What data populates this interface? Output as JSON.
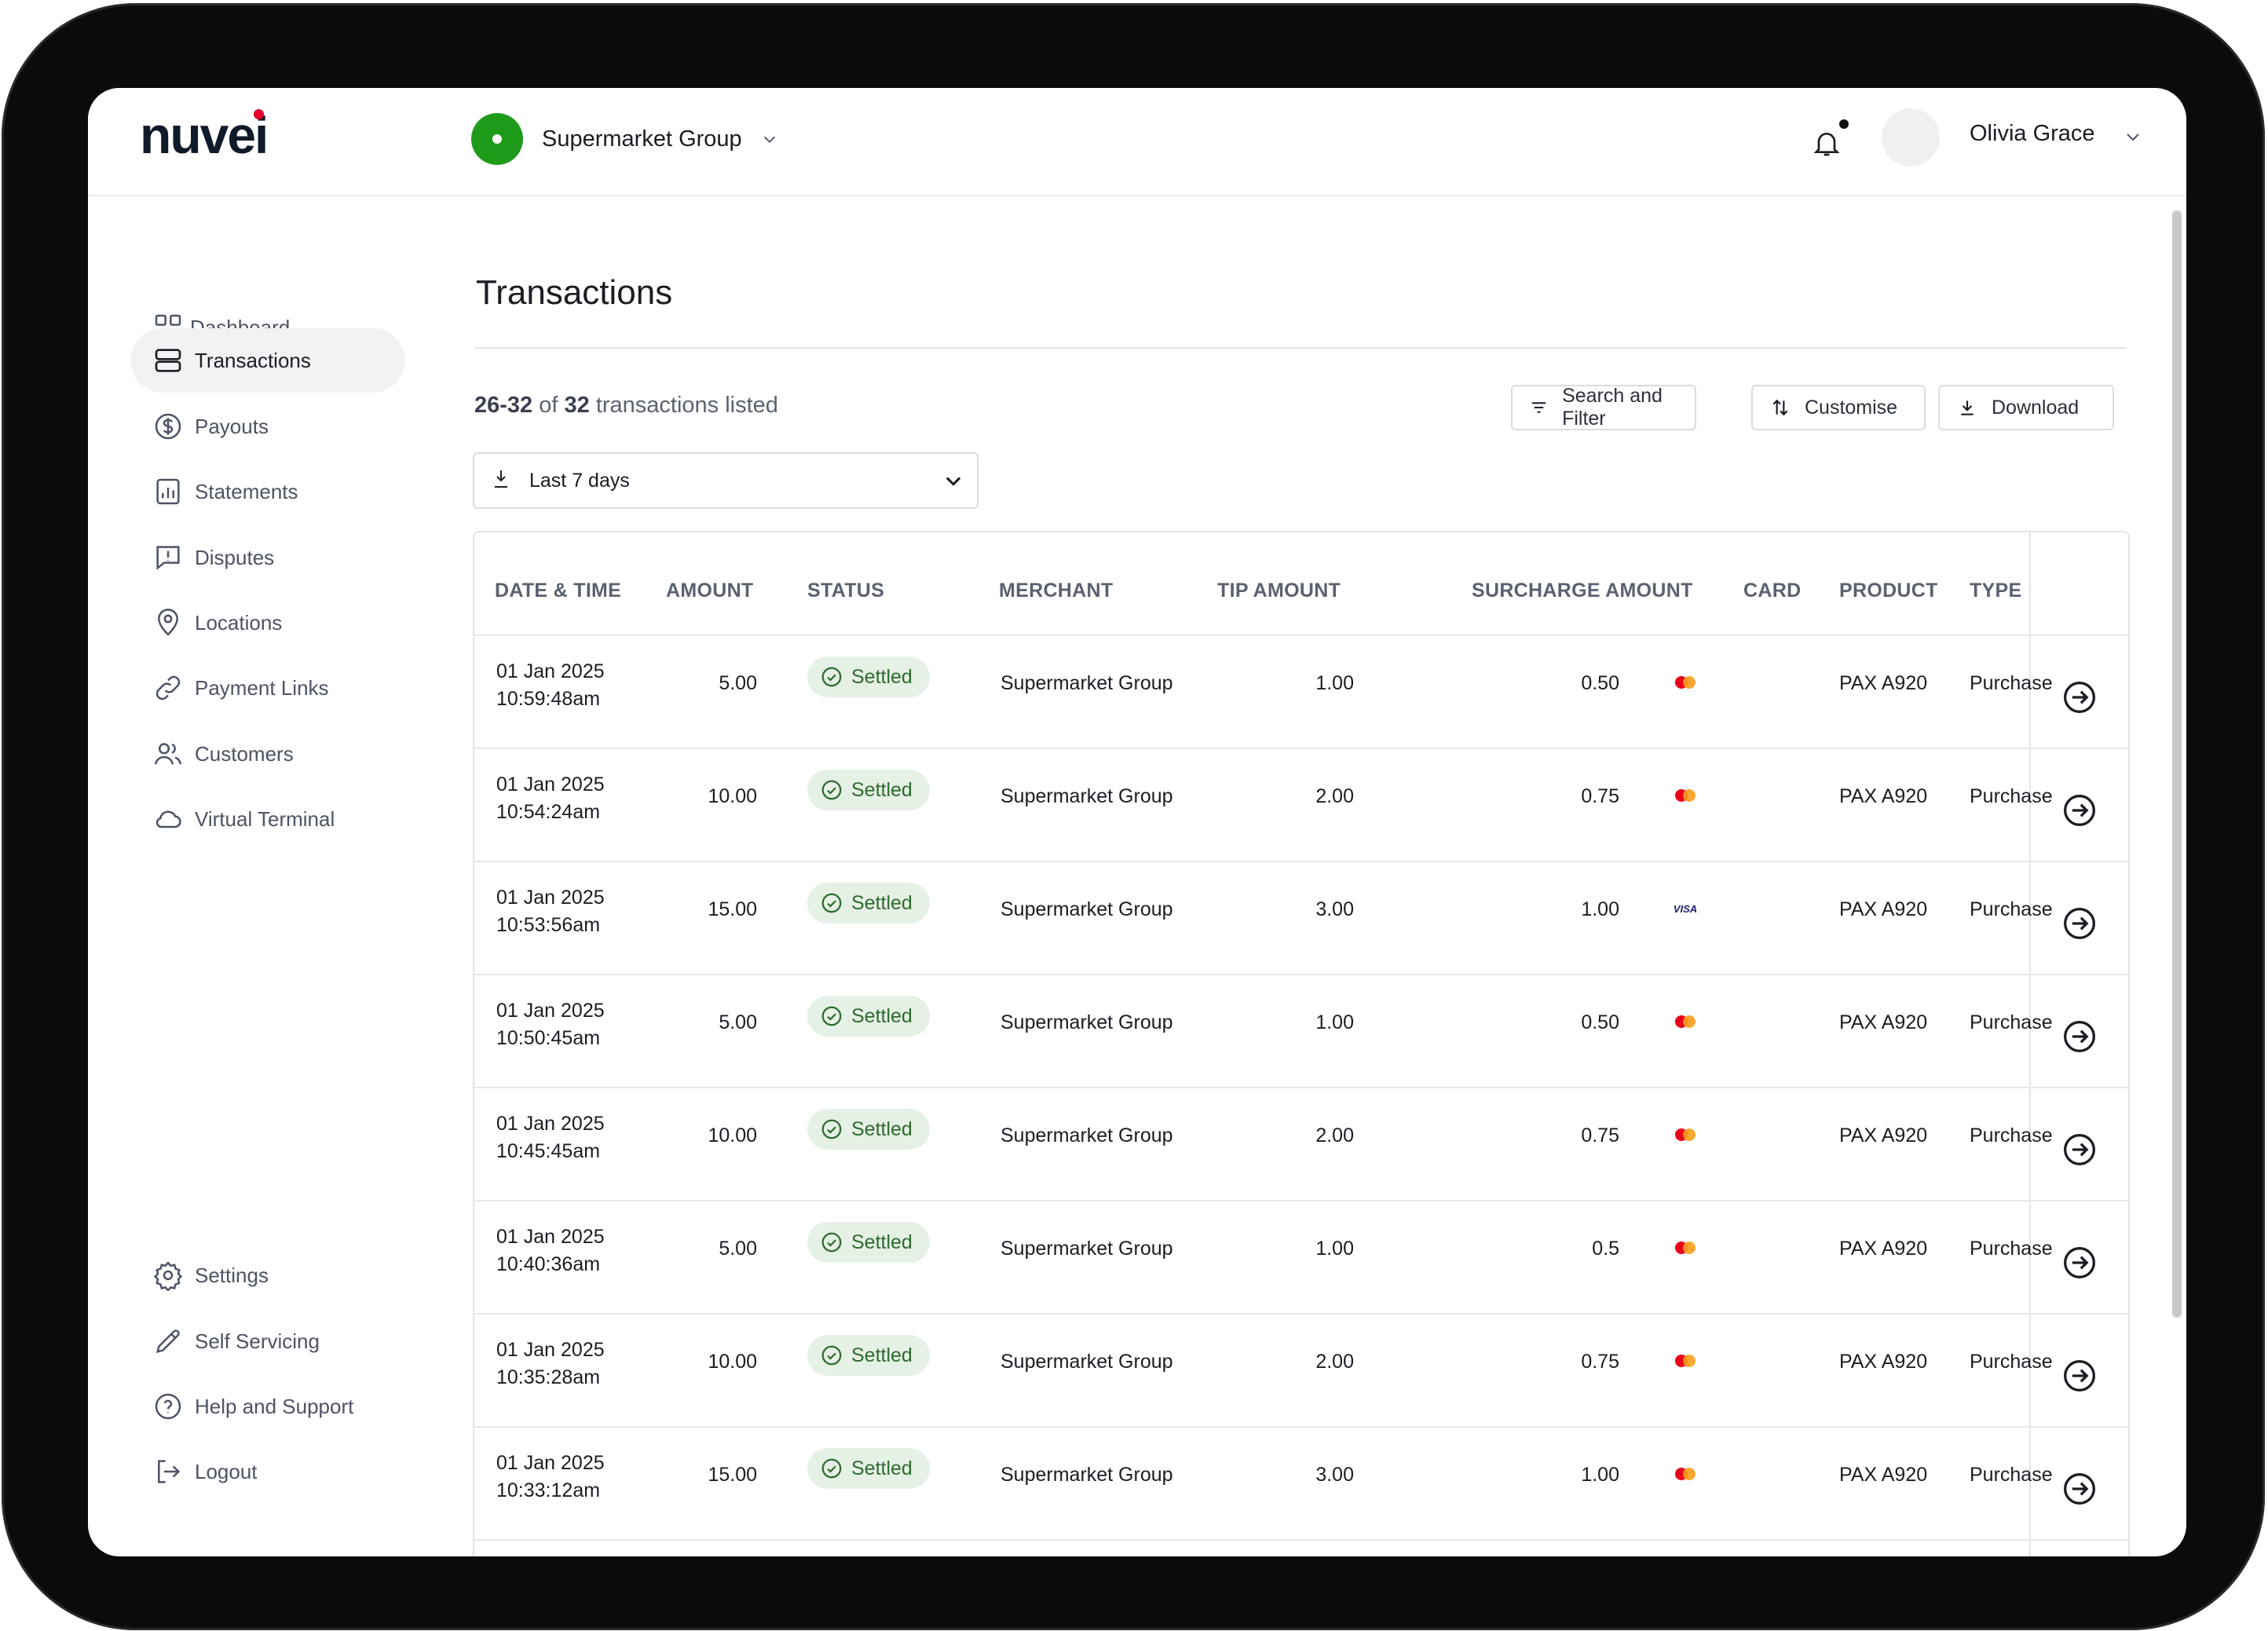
{
  "brand": {
    "logo_text": "nuvei",
    "accent": "#e4002b"
  },
  "header": {
    "merchant": "Supermarket Group",
    "merchant_color": "#1f9b1b",
    "user_name": "Olivia Grace",
    "notification_icon": "bell-icon"
  },
  "sidebar": {
    "items": [
      {
        "label": "Dashboard",
        "icon": "grid-icon"
      },
      {
        "label": "Transactions",
        "icon": "list-icon",
        "active": true
      },
      {
        "label": "Payouts",
        "icon": "dollar-circle-icon"
      },
      {
        "label": "Statements",
        "icon": "bar-chart-icon"
      },
      {
        "label": "Disputes",
        "icon": "message-alert-icon"
      },
      {
        "label": "Locations",
        "icon": "map-pin-icon"
      },
      {
        "label": "Payment Links",
        "icon": "link-icon"
      },
      {
        "label": "Customers",
        "icon": "users-icon"
      },
      {
        "label": "Virtual Terminal",
        "icon": "cloud-icon"
      }
    ],
    "bottom_items": [
      {
        "label": "Settings",
        "icon": "gear-icon"
      },
      {
        "label": "Self Servicing",
        "icon": "pencil-icon"
      },
      {
        "label": "Help and Support",
        "icon": "help-circle-icon"
      },
      {
        "label": "Logout",
        "icon": "logout-icon"
      }
    ]
  },
  "main": {
    "title": "Transactions",
    "count": {
      "range": "26-32",
      "of": "of",
      "total": "32",
      "suffix": "transactions listed"
    },
    "buttons": {
      "search_filter": "Search and Filter",
      "customise": "Customise",
      "download": "Download"
    },
    "date_filter": "Last 7 days"
  },
  "table": {
    "columns": [
      "DATE & TIME",
      "AMOUNT",
      "STATUS",
      "MERCHANT",
      "TIP AMOUNT",
      "SURCHARGE AMOUNT",
      "CARD",
      "PRODUCT",
      "TYPE"
    ],
    "rows": [
      {
        "date": "01 Jan 2025",
        "time": "10:59:48am",
        "amount": "5.00",
        "status": "Settled",
        "merchant": "Supermarket Group",
        "tip": "1.00",
        "surcharge": "0.50",
        "card": "mastercard",
        "product": "PAX A920",
        "type": "Purchase"
      },
      {
        "date": "01 Jan 2025",
        "time": "10:54:24am",
        "amount": "10.00",
        "status": "Settled",
        "merchant": "Supermarket Group",
        "tip": "2.00",
        "surcharge": "0.75",
        "card": "mastercard",
        "product": "PAX A920",
        "type": "Purchase"
      },
      {
        "date": "01 Jan 2025",
        "time": "10:53:56am",
        "amount": "15.00",
        "status": "Settled",
        "merchant": "Supermarket Group",
        "tip": "3.00",
        "surcharge": "1.00",
        "card": "visa",
        "product": "PAX A920",
        "type": "Purchase"
      },
      {
        "date": "01 Jan 2025",
        "time": "10:50:45am",
        "amount": "5.00",
        "status": "Settled",
        "merchant": "Supermarket Group",
        "tip": "1.00",
        "surcharge": "0.50",
        "card": "mastercard",
        "product": "PAX A920",
        "type": "Purchase"
      },
      {
        "date": "01 Jan 2025",
        "time": "10:45:45am",
        "amount": "10.00",
        "status": "Settled",
        "merchant": "Supermarket Group",
        "tip": "2.00",
        "surcharge": "0.75",
        "card": "mastercard",
        "product": "PAX A920",
        "type": "Purchase"
      },
      {
        "date": "01 Jan 2025",
        "time": "10:40:36am",
        "amount": "5.00",
        "status": "Settled",
        "merchant": "Supermarket Group",
        "tip": "1.00",
        "surcharge": "0.5",
        "card": "mastercard",
        "product": "PAX A920",
        "type": "Purchase"
      },
      {
        "date": "01 Jan 2025",
        "time": "10:35:28am",
        "amount": "10.00",
        "status": "Settled",
        "merchant": "Supermarket Group",
        "tip": "2.00",
        "surcharge": "0.75",
        "card": "mastercard",
        "product": "PAX A920",
        "type": "Purchase"
      },
      {
        "date": "01 Jan 2025",
        "time": "10:33:12am",
        "amount": "15.00",
        "status": "Settled",
        "merchant": "Supermarket Group",
        "tip": "3.00",
        "surcharge": "1.00",
        "card": "mastercard",
        "product": "PAX A920",
        "type": "Purchase"
      }
    ],
    "status_color": "#2c6b2c"
  }
}
